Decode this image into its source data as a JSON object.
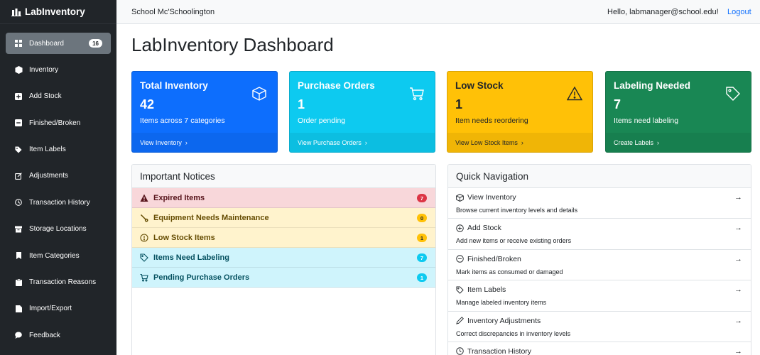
{
  "app": {
    "title": "LabInventory"
  },
  "sidebar": {
    "items": [
      {
        "label": "Dashboard",
        "icon": "grid-icon",
        "badge": "16"
      },
      {
        "label": "Inventory",
        "icon": "box-icon"
      },
      {
        "label": "Add Stock",
        "icon": "plus-square-icon"
      },
      {
        "label": "Finished/Broken",
        "icon": "minus-square-icon"
      },
      {
        "label": "Item Labels",
        "icon": "tag-icon"
      },
      {
        "label": "Adjustments",
        "icon": "pencil-square-icon"
      },
      {
        "label": "Transaction History",
        "icon": "clock-icon"
      },
      {
        "label": "Storage Locations",
        "icon": "archive-icon"
      },
      {
        "label": "Item Categories",
        "icon": "bookmark-icon"
      },
      {
        "label": "Transaction Reasons",
        "icon": "clipboard-icon"
      },
      {
        "label": "Import/Export",
        "icon": "file-icon"
      },
      {
        "label": "Feedback",
        "icon": "chat-icon"
      }
    ]
  },
  "topbar": {
    "school": "School Mc'Schoolington",
    "greeting": "Hello, labmanager@school.edu!",
    "logout": "Logout"
  },
  "main": {
    "title": "LabInventory Dashboard",
    "cards": [
      {
        "title": "Total Inventory",
        "number": "42",
        "subtitle": "Items across 7 categories",
        "link": "View Inventory",
        "icon": "box-icon",
        "color": "#0d6efd"
      },
      {
        "title": "Purchase Orders",
        "number": "1",
        "subtitle": "Order pending",
        "link": "View Purchase Orders",
        "icon": "cart-icon",
        "color": "#0dcaf0"
      },
      {
        "title": "Low Stock",
        "number": "1",
        "subtitle": "Item needs reordering",
        "link": "View Low Stock Items",
        "icon": "warning-icon",
        "color": "#ffc107"
      },
      {
        "title": "Labeling Needed",
        "number": "7",
        "subtitle": "Items need labeling",
        "link": "Create Labels",
        "icon": "tag-icon",
        "color": "#198754"
      }
    ],
    "notices": {
      "header": "Important Notices",
      "items": [
        {
          "label": "Expired Items",
          "count": "7",
          "icon": "warning-icon",
          "badge_color": "#dc3545"
        },
        {
          "label": "Equipment Needs Maintenance",
          "count": "0",
          "icon": "wrench-icon",
          "badge_color": "#ffc107"
        },
        {
          "label": "Low Stock Items",
          "count": "1",
          "icon": "exclamation-circle-icon",
          "badge_color": "#ffc107"
        },
        {
          "label": "Items Need Labeling",
          "count": "7",
          "icon": "tag-icon",
          "badge_color": "#0dcaf0"
        },
        {
          "label": "Pending Purchase Orders",
          "count": "1",
          "icon": "cart-icon",
          "badge_color": "#0dcaf0"
        }
      ]
    },
    "quicknav": {
      "header": "Quick Navigation",
      "arrow": "→",
      "items": [
        {
          "title": "View Inventory",
          "desc": "Browse current inventory levels and details",
          "icon": "box-icon"
        },
        {
          "title": "Add Stock",
          "desc": "Add new items or receive existing orders",
          "icon": "plus-circle-icon"
        },
        {
          "title": "Finished/Broken",
          "desc": "Mark items as consumed or damaged",
          "icon": "minus-circle-icon"
        },
        {
          "title": "Item Labels",
          "desc": "Manage labeled inventory items",
          "icon": "tag-icon"
        },
        {
          "title": "Inventory Adjustments",
          "desc": "Correct discrepancies in inventory levels",
          "icon": "pencil-icon"
        },
        {
          "title": "Transaction History",
          "desc": "",
          "icon": "clock-icon"
        }
      ]
    }
  }
}
